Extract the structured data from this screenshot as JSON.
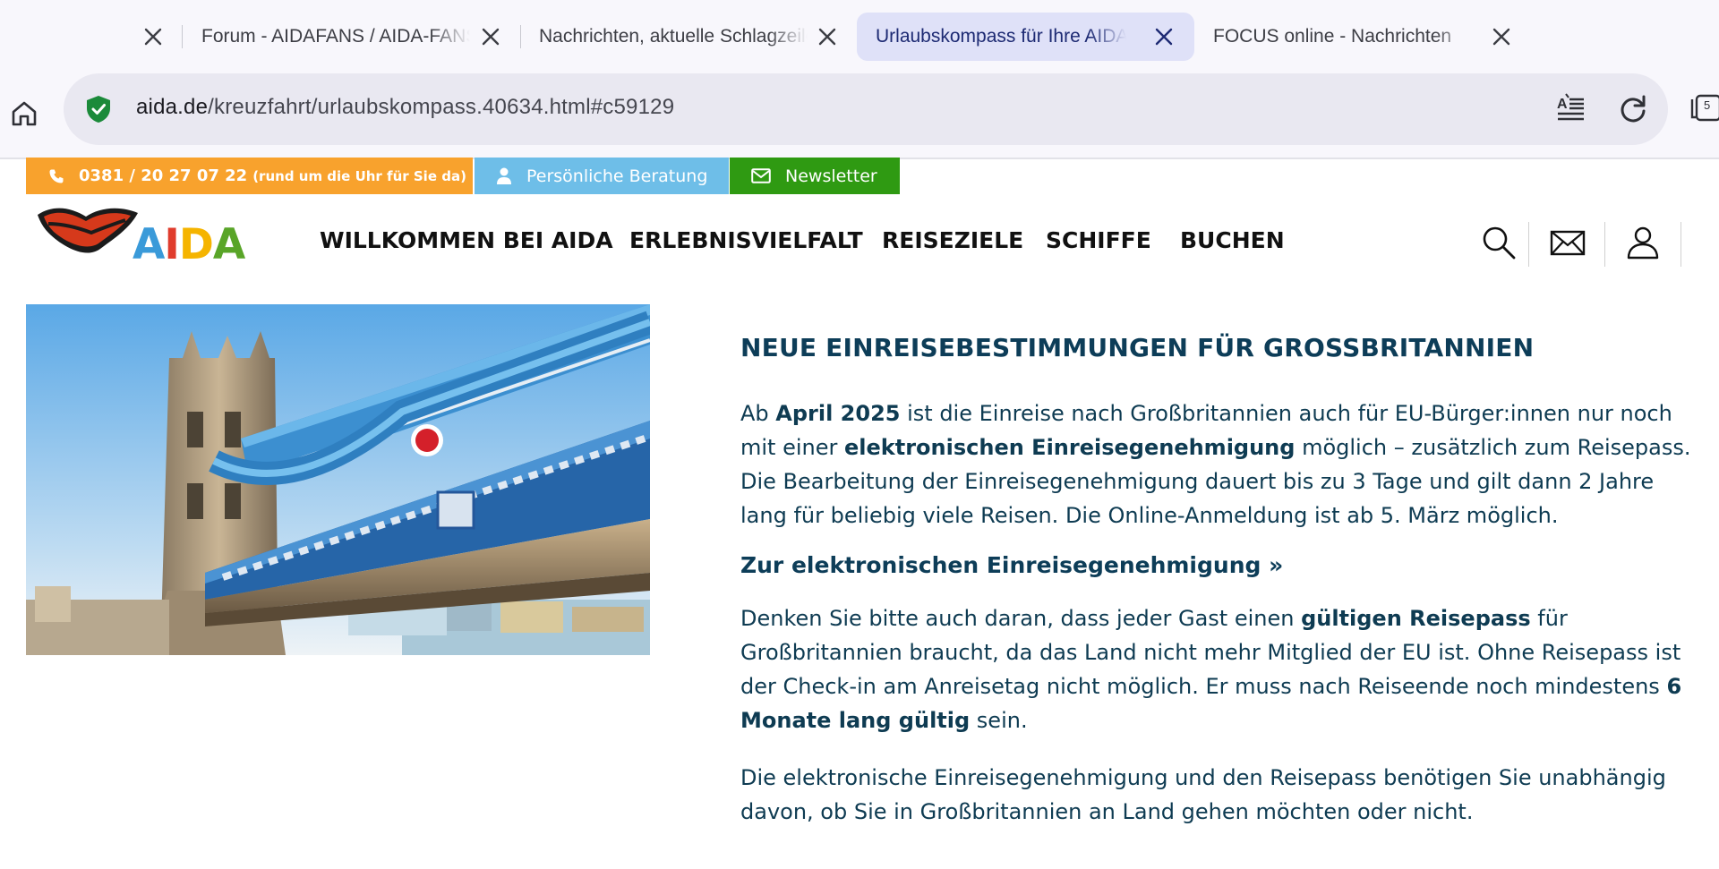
{
  "browser": {
    "tabs": [
      {
        "label": "Forum - AIDAFANS / AIDA-FANS",
        "active": false
      },
      {
        "label": "Nachrichten, aktuelle Schlagzeilen",
        "active": false
      },
      {
        "label": "Urlaubskompass für Ihre AIDA Kreuzfahrt",
        "active": true
      },
      {
        "label": "FOCUS online - Nachrichten",
        "active": false
      }
    ],
    "url_domain": "aida.de",
    "url_path": "/kreuzfahrt/urlaubskompass.40634.html#c59129",
    "tab_count": "5"
  },
  "service_bar": {
    "phone": "0381 / 20 27 07 22",
    "phone_note": "(rund um die Uhr für Sie da)",
    "beratung": "Persönliche Beratung",
    "newsletter": "Newsletter"
  },
  "header": {
    "logo_text": "AIDA",
    "nav": [
      "WILLKOMMEN BEI AIDA",
      "ERLEBNISVIELFALT",
      "REISEZIELE",
      "SCHIFFE",
      "BUCHEN"
    ]
  },
  "article": {
    "title": "NEUE EINREISEBESTIMMUNGEN FÜR GROSSBRITANNIEN",
    "p1": {
      "t1": "Ab ",
      "b1": "April 2025",
      "t2": " ist die Einreise nach Großbritannien auch für EU-Bürger:innen nur noch mit einer ",
      "b2": "elektronischen Einreisegenehmigung",
      "t3": " möglich – zusätzlich zum Reisepass. Die Bearbeitung der Einreisegenehmigung dauert bis zu 3 Tage und gilt dann 2 Jahre lang für beliebig viele Reisen. Die Online-Anmeldung ist ab 5. März möglich."
    },
    "link": "Zur elektronischen Einreisegenehmigung »",
    "p2": {
      "t1": "Denken Sie bitte auch daran, dass jeder Gast einen ",
      "b1": "gültigen Reisepass",
      "t2": " für Großbritannien braucht, da das Land nicht mehr Mitglied der EU ist. Ohne Reisepass ist der Check-in am Anreisetag nicht möglich. Er muss nach Reiseende noch mindestens ",
      "b2": "6 Monate lang gültig",
      "t3": " sein."
    },
    "p3": "Die elektronische Einreisegenehmigung und den Reisepass benötigen Sie unabhängig davon, ob Sie in Großbritannien an Land gehen möchten oder nicht."
  },
  "colors": {
    "phone_bg": "#f8a22d",
    "beratung_bg": "#6ebee8",
    "newsletter_bg": "#2f9a12",
    "text": "#0e3b52",
    "active_tab": "#dfe1f8"
  }
}
